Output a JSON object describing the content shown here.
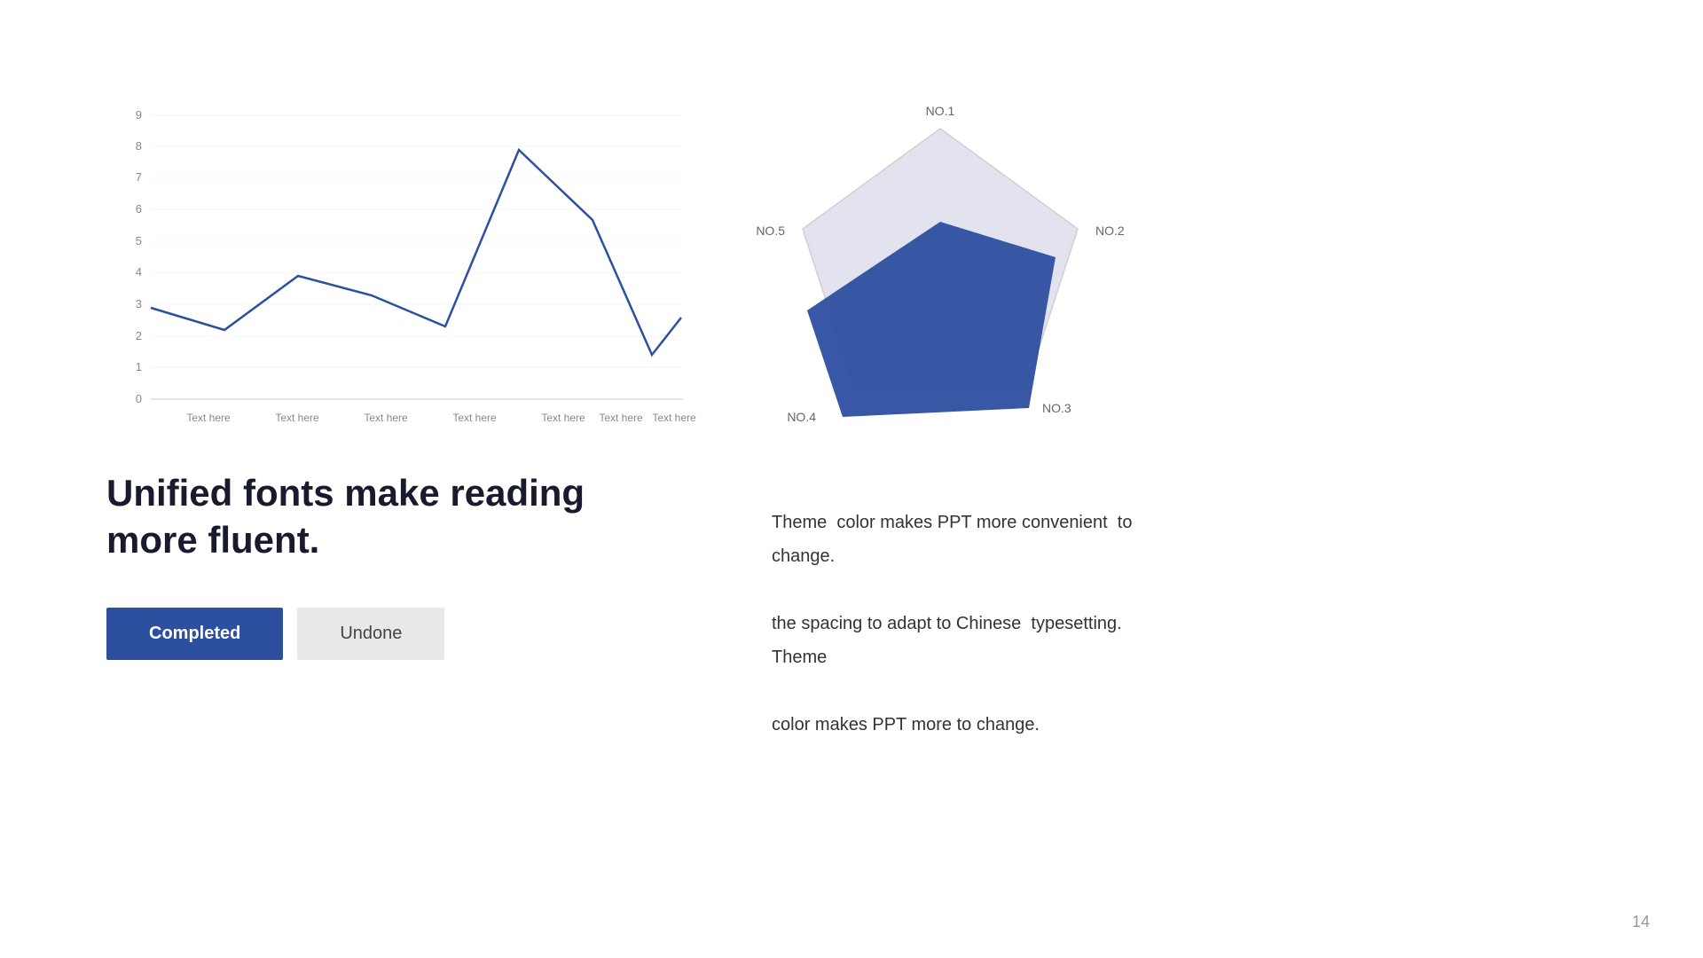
{
  "page": {
    "number": "14",
    "background": "#ffffff"
  },
  "line_chart": {
    "y_labels": [
      "0",
      "1",
      "2",
      "3",
      "4",
      "5",
      "6",
      "7",
      "8",
      "9"
    ],
    "x_labels": [
      "Text here",
      "Text here",
      "Text here",
      "Text here",
      "Text here",
      "Text here",
      "Text here"
    ],
    "data_points": [
      {
        "x": 0,
        "y": 2.9
      },
      {
        "x": 1,
        "y": 2.2
      },
      {
        "x": 2,
        "y": 3.9
      },
      {
        "x": 3,
        "y": 3.3
      },
      {
        "x": 4,
        "y": 2.3
      },
      {
        "x": 5,
        "y": 7.9
      },
      {
        "x": 6,
        "y": 5.7
      },
      {
        "x": 7,
        "y": 1.4
      },
      {
        "x": 8,
        "y": 2.6
      }
    ],
    "line_color": "#2d4fa0"
  },
  "radar_chart": {
    "labels": [
      "NO.1",
      "NO.2",
      "NO.3",
      "NO.4",
      "NO.5"
    ],
    "outer_color": "#d0d0e8",
    "inner_color": "#2d4fa0"
  },
  "headline": {
    "line1": "Unified fonts make reading",
    "line2": "more fluent."
  },
  "buttons": {
    "completed": "Completed",
    "undone": "Undone"
  },
  "description": "Theme  color makes PPT more convenient  to change.\nthe spacing to adapt to Chinese  typesetting. Theme\ncolor makes PPT more to change."
}
